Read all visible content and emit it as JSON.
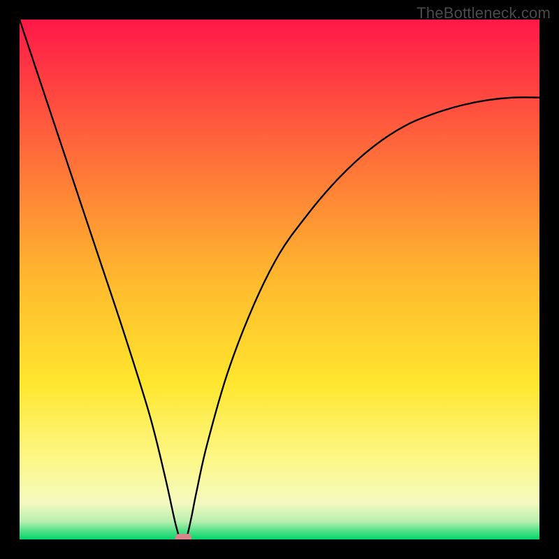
{
  "watermark": "TheBottleneck.com",
  "chart_data": {
    "type": "line",
    "title": "",
    "xlabel": "",
    "ylabel": "",
    "xlim": [
      0,
      100
    ],
    "ylim": [
      0,
      100
    ],
    "grid": false,
    "background": {
      "style": "vertical-gradient",
      "stops": [
        {
          "pos": 0.0,
          "color": "#ff1848"
        },
        {
          "pos": 0.25,
          "color": "#ff6a3a"
        },
        {
          "pos": 0.5,
          "color": "#ffb92e"
        },
        {
          "pos": 0.7,
          "color": "#ffe62e"
        },
        {
          "pos": 0.85,
          "color": "#fcf88a"
        },
        {
          "pos": 0.93,
          "color": "#f4fac0"
        },
        {
          "pos": 0.965,
          "color": "#b8f0b0"
        },
        {
          "pos": 0.985,
          "color": "#4be085"
        },
        {
          "pos": 1.0,
          "color": "#00d66a"
        }
      ]
    },
    "series": [
      {
        "name": "bottleneck-curve",
        "color": "#000000",
        "x": [
          0,
          5,
          10,
          15,
          20,
          25,
          28,
          30,
          31,
          32,
          33,
          34,
          36,
          40,
          45,
          50,
          55,
          60,
          65,
          70,
          75,
          80,
          85,
          90,
          95,
          100
        ],
        "y": [
          100,
          85,
          70,
          55,
          40,
          24,
          12,
          3,
          0,
          0,
          4,
          9,
          18,
          32,
          45,
          55,
          62,
          68,
          73,
          77,
          80,
          82,
          83.5,
          84.5,
          85,
          85
        ]
      }
    ],
    "markers": [
      {
        "name": "optimum-marker",
        "x": 31.5,
        "y": 0,
        "shape": "rounded-rect",
        "color": "#d9838c",
        "w": 3.2,
        "h": 1.6
      }
    ]
  }
}
